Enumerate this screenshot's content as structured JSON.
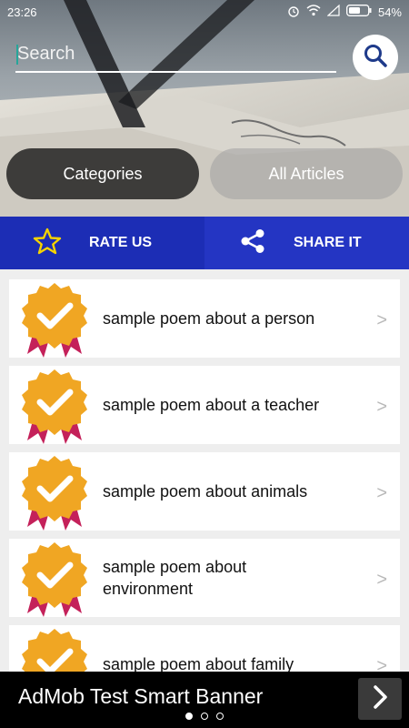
{
  "status_bar": {
    "time": "23:26",
    "battery": "54%",
    "icons": [
      "alarm-icon",
      "wifi-icon",
      "signal-icon",
      "battery-icon"
    ]
  },
  "search": {
    "placeholder": "Search",
    "value": "",
    "icon": "search-icon"
  },
  "header": {
    "buttons": [
      {
        "label": "Categories"
      },
      {
        "label": "All Articles"
      }
    ]
  },
  "actions": {
    "rate": {
      "label": "RATE US",
      "icon": "star-icon"
    },
    "share": {
      "label": "SHARE IT",
      "icon": "share-icon"
    }
  },
  "articles": [
    {
      "title": "sample poem about a person",
      "icon": "badge-check-icon"
    },
    {
      "title": "sample poem about a teacher",
      "icon": "badge-check-icon"
    },
    {
      "title": "sample poem about animals",
      "icon": "badge-check-icon"
    },
    {
      "title": "sample poem about environment",
      "icon": "badge-check-icon"
    },
    {
      "title": "sample poem about family",
      "icon": "badge-check-icon"
    }
  ],
  "chevron": ">",
  "ad": {
    "text": "AdMob Test Smart Banner",
    "page_dots": 3,
    "active_dot": 1
  },
  "colors": {
    "action_bar": "#1c2db5",
    "badge": "#f0a623",
    "ribbon": "#c4215a",
    "ad_background": "#000000"
  }
}
